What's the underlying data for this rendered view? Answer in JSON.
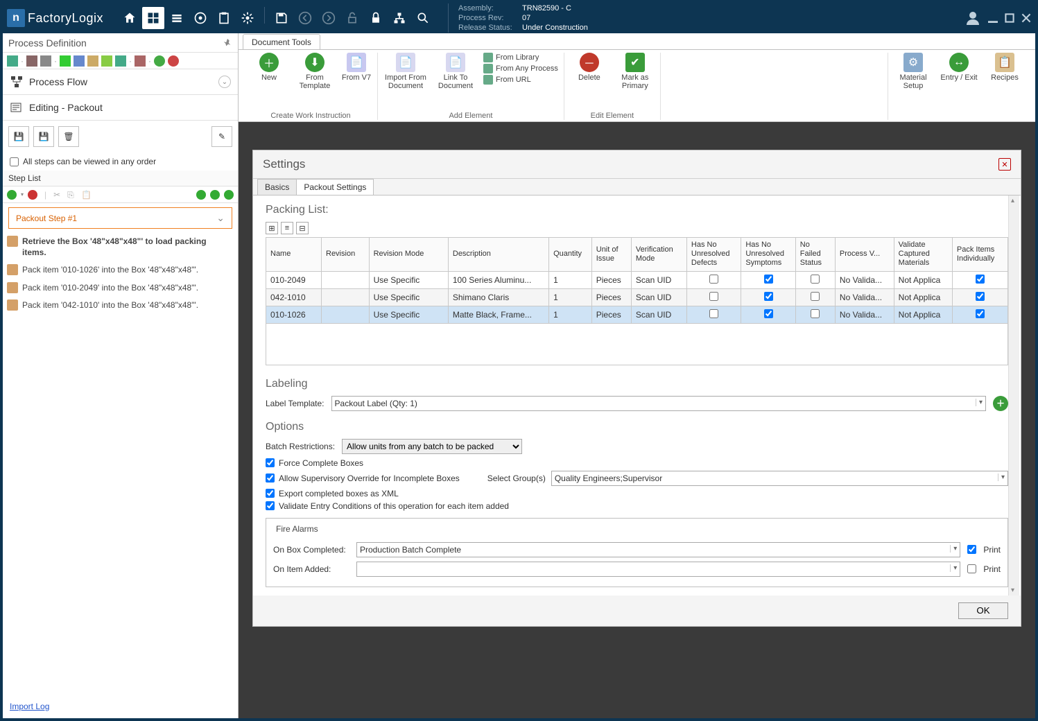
{
  "brand": "FactoryLogix",
  "assembly": {
    "label_assembly": "Assembly:",
    "assembly": "TRN82590 - C",
    "label_rev": "Process Rev:",
    "rev": "07",
    "label_status": "Release Status:",
    "status": "Under Construction"
  },
  "sidebar": {
    "title": "Process Definition",
    "flow_label": "Process Flow",
    "editing_label": "Editing - Packout",
    "all_steps_label": "All steps can be viewed in any order",
    "step_list_label": "Step List",
    "step_name": "Packout Step #1",
    "substeps": [
      "Retrieve the Box '48\"x48\"x48\"' to load packing items.",
      "Pack item '010-1026' into the Box '48\"x48\"x48\"'.",
      "Pack item '010-2049' into the Box '48\"x48\"x48\"'.",
      "Pack item '042-1010' into the Box '48\"x48\"x48\"'."
    ],
    "import_log": "Import Log"
  },
  "doc_tab": "Document Tools",
  "ribbon": {
    "group1": {
      "label": "Create Work Instruction",
      "new": "New",
      "from_template": "From Template",
      "from_v7": "From V7"
    },
    "group2": {
      "label": "Add Element",
      "import_doc": "Import From Document",
      "link_doc": "Link To Document",
      "from_library": "From Library",
      "from_any": "From Any Process",
      "from_url": "From URL"
    },
    "group3": {
      "label": "Edit Element",
      "delete": "Delete",
      "primary": "Mark as Primary"
    },
    "right": {
      "material": "Material Setup",
      "entry": "Entry / Exit",
      "recipes": "Recipes"
    }
  },
  "settings": {
    "title": "Settings",
    "tabs": {
      "basics": "Basics",
      "packout": "Packout Settings"
    },
    "packing_list": "Packing List:",
    "columns": [
      "Name",
      "Revision",
      "Revision Mode",
      "Description",
      "Quantity",
      "Unit of Issue",
      "Verification Mode",
      "Has No Unresolved Defects",
      "Has No Unresolved Symptoms",
      "No Failed Status",
      "Process V...",
      "Validate Captured Materials",
      "Pack Items Individually"
    ],
    "rows": [
      {
        "name": "010-2049",
        "rev": "",
        "rmode": "Use Specific",
        "desc": "100 Series Aluminu...",
        "qty": "1",
        "uoi": "Pieces",
        "vmode": "Scan UID",
        "defects": false,
        "symptoms": true,
        "failed": false,
        "procv": "No Valida...",
        "vcm": "Not Applica",
        "pii": true
      },
      {
        "name": "042-1010",
        "rev": "",
        "rmode": "Use Specific",
        "desc": "Shimano Claris",
        "qty": "1",
        "uoi": "Pieces",
        "vmode": "Scan UID",
        "defects": false,
        "symptoms": true,
        "failed": false,
        "procv": "No Valida...",
        "vcm": "Not Applica",
        "pii": true
      },
      {
        "name": "010-1026",
        "rev": "",
        "rmode": "Use Specific",
        "desc": "Matte Black, Frame...",
        "qty": "1",
        "uoi": "Pieces",
        "vmode": "Scan UID",
        "defects": false,
        "symptoms": true,
        "failed": false,
        "procv": "No Valida...",
        "vcm": "Not Applica",
        "pii": true
      }
    ],
    "labeling": {
      "title": "Labeling",
      "label_template": "Label Template:",
      "value": "Packout Label (Qty: 1)"
    },
    "options": {
      "title": "Options",
      "batch_label": "Batch Restrictions:",
      "batch_value": "Allow units from any batch to be packed",
      "force": "Force Complete Boxes",
      "supervisory": "Allow Supervisory Override for Incomplete Boxes",
      "group_label": "Select Group(s)",
      "group_value": "Quality Engineers;Supervisor",
      "export": "Export completed boxes as XML",
      "validate": "Validate Entry Conditions of this operation for each item added"
    },
    "fire": {
      "title": "Fire Alarms",
      "box_label": "On Box Completed:",
      "box_value": "Production Batch Complete",
      "item_label": "On Item Added:",
      "print": "Print"
    },
    "ok": "OK"
  }
}
